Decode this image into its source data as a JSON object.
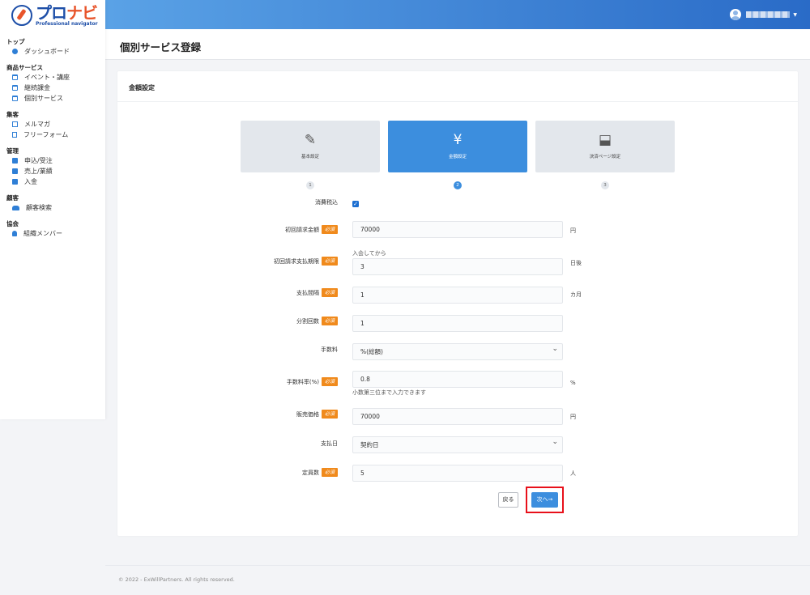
{
  "brand": {
    "name_left": "プロ",
    "name_right": "ナビ",
    "tagline": "Professional navigator"
  },
  "sidebar": {
    "sections": [
      {
        "title": "トップ",
        "items": [
          {
            "label": "ダッシュボード",
            "icon": "dashboard-icon"
          }
        ]
      },
      {
        "title": "商品サービス",
        "items": [
          {
            "label": "イベント・講座",
            "icon": "calendar-icon"
          },
          {
            "label": "継続課金",
            "icon": "calendar-icon"
          },
          {
            "label": "個別サービス",
            "icon": "calendar-icon"
          }
        ]
      },
      {
        "title": "集客",
        "items": [
          {
            "label": "メルマガ",
            "icon": "mail-icon"
          },
          {
            "label": "フリーフォーム",
            "icon": "document-icon"
          }
        ]
      },
      {
        "title": "管理",
        "items": [
          {
            "label": "申込/受注",
            "icon": "box-icon"
          },
          {
            "label": "売上/業績",
            "icon": "box-icon"
          },
          {
            "label": "入金",
            "icon": "box-icon"
          }
        ]
      },
      {
        "title": "顧客",
        "items": [
          {
            "label": "顧客検索",
            "icon": "users-icon"
          }
        ]
      },
      {
        "title": "協会",
        "items": [
          {
            "label": "組織メンバー",
            "icon": "user-icon"
          }
        ]
      }
    ]
  },
  "page": {
    "title": "個別サービス登録",
    "card_title": "金額設定"
  },
  "steps": [
    {
      "label": "基本設定",
      "num": "1",
      "icon": "edit-icon",
      "glyph": "✎"
    },
    {
      "label": "金額設定",
      "num": "2",
      "icon": "yen-icon",
      "glyph": "¥"
    },
    {
      "label": "決済ページ設定",
      "num": "3",
      "icon": "stamp-icon",
      "glyph": "⬓"
    }
  ],
  "form": {
    "tax": {
      "label": "消費税込",
      "checked": true
    },
    "initial_amount": {
      "label": "初回請求金額",
      "value": "70000",
      "unit": "円"
    },
    "initial_deadline": {
      "label": "初回請求支払期限",
      "hint": "入会してから",
      "value": "3",
      "unit": "日後"
    },
    "interval": {
      "label": "支払間隔",
      "value": "1",
      "unit": "カ月"
    },
    "installments": {
      "label": "分割回数",
      "value": "1"
    },
    "fee": {
      "label": "手数料",
      "value": "%(総額)"
    },
    "fee_rate": {
      "label": "手数料率(%)",
      "value": "0.8",
      "unit": "%",
      "hint": "小数第三位まで入力できます"
    },
    "price": {
      "label": "販売価格",
      "value": "70000",
      "unit": "円"
    },
    "pay_day": {
      "label": "支払日",
      "value": "契約日"
    },
    "capacity": {
      "label": "定員数",
      "value": "5",
      "unit": "人"
    },
    "required_label": "必須"
  },
  "buttons": {
    "back": "戻る",
    "next": "次へ→"
  },
  "footer": "© 2022 - ExWillPartners. All rights reserved."
}
